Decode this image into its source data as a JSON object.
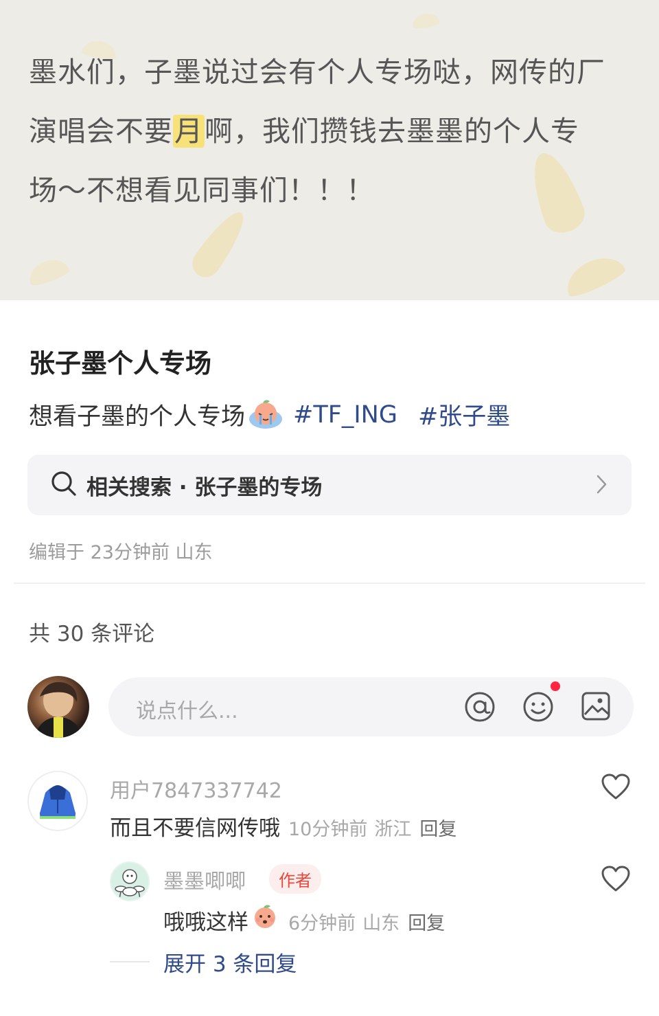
{
  "hero": {
    "line1": "墨水们，子墨说过会有个人专场哒，网传的厂",
    "line2_pre": "演唱会不要",
    "line2_hl": "月",
    "line2_post": "啊，我们攒钱去墨墨的个人专",
    "line3": "场～不想看见同事们！！！",
    "highlight_color": "#f7e27a"
  },
  "post": {
    "title": "张子墨个人专场",
    "body": "想看子墨的个人专场",
    "emoji": "crying-peach-emoji",
    "tags": [
      "#TF_ING",
      "#张子墨"
    ],
    "tag_color": "#2f4b8c"
  },
  "related_search": {
    "icon": "search-icon",
    "label": "相关搜索 · 张子墨的专场",
    "chevron": "chevron-right-icon"
  },
  "edit_info": "编辑于 23分钟前 山东",
  "comments_header": "共 30 条评论",
  "input": {
    "placeholder": "说点什么...",
    "icons": [
      "at-icon",
      "emoji-icon",
      "image-icon"
    ]
  },
  "comments": [
    {
      "user": "用户7847337742",
      "text": "而且不要信网传哦",
      "time": "10分钟前",
      "location": "浙江",
      "reply_label": "回复",
      "avatar": "blue-hoodie-avatar"
    }
  ],
  "reply": {
    "user": "墨墨唧唧",
    "badge": "作者",
    "text": "哦哦这样",
    "emoji": "peach-emoji",
    "time": "6分钟前",
    "location": "山东",
    "reply_label": "回复",
    "avatar": "sheep-drummer-avatar"
  },
  "expand_label": "展开 3 条回复"
}
